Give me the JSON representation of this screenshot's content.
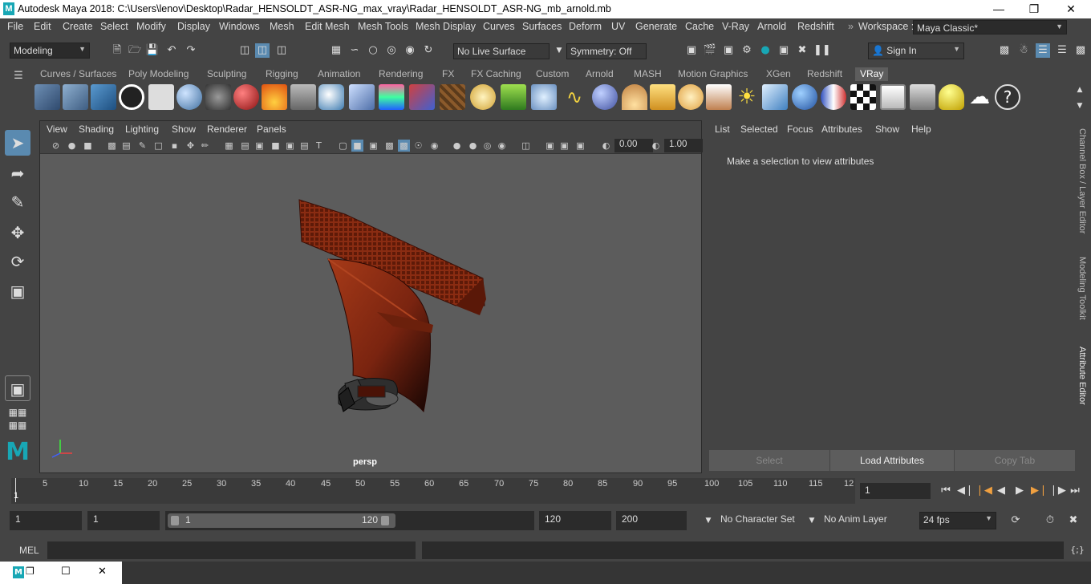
{
  "window": {
    "title": "Autodesk Maya 2018: C:\\Users\\lenov\\Desktop\\Radar_HENSOLDT_ASR-NG_max_vray\\Radar_HENSOLDT_ASR-NG_mb_arnold.mb",
    "logo": "M"
  },
  "menus": [
    "File",
    "Edit",
    "Create",
    "Select",
    "Modify",
    "Display",
    "Windows",
    "Mesh",
    "Edit Mesh",
    "Mesh Tools",
    "Mesh Display",
    "Curves",
    "Surfaces",
    "Deform",
    "UV",
    "Generate",
    "Cache",
    "V-Ray",
    "Arnold",
    "Redshift"
  ],
  "workspace": {
    "label": "Workspace :",
    "value": "Maya Classic*"
  },
  "statusline": {
    "mode": "Modeling",
    "live_surface": "No Live Surface",
    "symmetry": "Symmetry: Off",
    "sign_in": "Sign In"
  },
  "shelf_tabs": [
    "Curves / Surfaces",
    "Poly Modeling",
    "Sculpting",
    "Rigging",
    "Animation",
    "Rendering",
    "FX",
    "FX Caching",
    "Custom",
    "Arnold",
    "MASH",
    "Motion Graphics",
    "XGen",
    "Redshift",
    "VRay"
  ],
  "shelf_active": "VRay",
  "viewport": {
    "menus": [
      "View",
      "Shading",
      "Lighting",
      "Show",
      "Renderer",
      "Panels"
    ],
    "near_value": "0.00",
    "far_value": "1.00",
    "camera_label": "persp"
  },
  "attribute_editor": {
    "menus": [
      "List",
      "Selected",
      "Focus",
      "Attributes",
      "Show",
      "Help"
    ],
    "message": "Make a selection to view attributes",
    "buttons": {
      "select": "Select",
      "load": "Load Attributes",
      "copy": "Copy Tab"
    }
  },
  "side_tabs": {
    "channel_box": "Channel Box / Layer Editor",
    "modeling_toolkit": "Modeling Toolkit",
    "attribute_editor": "Attribute Editor"
  },
  "timeline": {
    "labels": [
      "5",
      "10",
      "15",
      "20",
      "25",
      "30",
      "35",
      "40",
      "45",
      "50",
      "55",
      "60",
      "65",
      "70",
      "75",
      "80",
      "85",
      "90",
      "95",
      "100",
      "105",
      "110",
      "115",
      "12"
    ],
    "start_marker": "1",
    "current_frame": "1"
  },
  "range": {
    "start": "1",
    "playback_start": "1",
    "slider_start": "1",
    "slider_end": "120",
    "playback_end": "120",
    "end": "200",
    "character_set": "No Character Set",
    "anim_layer": "No Anim Layer",
    "fps": "24 fps"
  },
  "command_line": {
    "label": "MEL"
  },
  "colors": {
    "bg": "#444444",
    "viewport": "#5c5c5c",
    "field": "#2b2b2b",
    "accent": "#18a7b5",
    "model": "#8a2c12"
  }
}
